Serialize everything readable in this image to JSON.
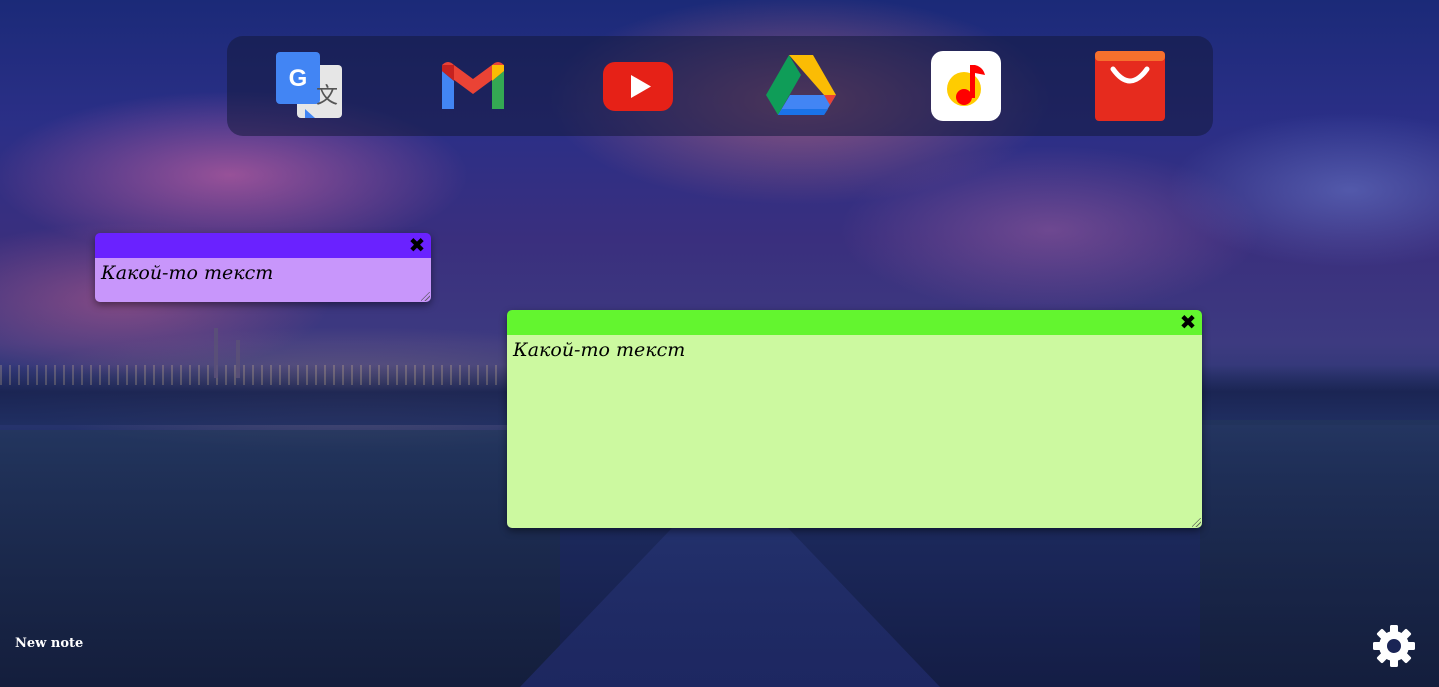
{
  "bookmarks": [
    {
      "name": "Google Translate",
      "icon": "google-translate-icon"
    },
    {
      "name": "Gmail",
      "icon": "gmail-icon"
    },
    {
      "name": "YouTube",
      "icon": "youtube-icon"
    },
    {
      "name": "Google Drive",
      "icon": "google-drive-icon"
    },
    {
      "name": "Yandex Music",
      "icon": "yandex-music-icon"
    },
    {
      "name": "AliExpress",
      "icon": "aliexpress-icon"
    }
  ],
  "notes": [
    {
      "text": "Какой-то текст",
      "close_symbol": "✖",
      "header_color": "#6a22ff",
      "body_color": "#c896fb"
    },
    {
      "text": "Какой-то текст",
      "close_symbol": "✖",
      "header_color": "#63f52f",
      "body_color": "#ccf9a0"
    }
  ],
  "footer": {
    "new_note_label": "New note",
    "settings_icon": "gear-icon"
  }
}
